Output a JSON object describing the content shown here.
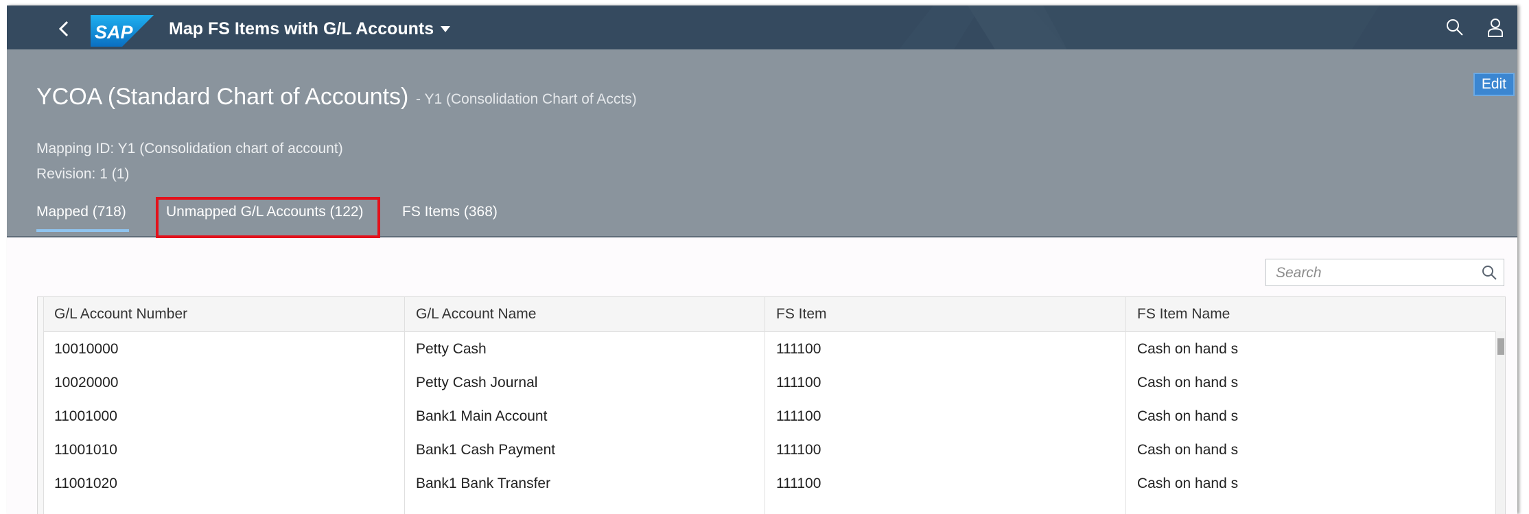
{
  "shell": {
    "app_title": "Map FS Items with G/L Accounts",
    "brand_color": "#354a5f",
    "icons": [
      "back-icon",
      "sap-logo",
      "search-icon",
      "user-icon"
    ]
  },
  "header": {
    "title": "YCOA (Standard Chart of Accounts)",
    "subtitle": "- Y1 (Consolidation Chart of Accts)",
    "edit_label": "Edit",
    "mapping_id": "Mapping ID: Y1 (Consolidation chart of account)",
    "revision": "Revision: 1 (1)",
    "background_color": "#8a949d"
  },
  "tabs": [
    {
      "label": "Mapped (718)",
      "selected": true
    },
    {
      "label": "Unmapped G/L Accounts (122)",
      "selected": false,
      "highlighted": true
    },
    {
      "label": "FS Items (368)",
      "selected": false
    }
  ],
  "highlight_color": "#e3111b",
  "search": {
    "placeholder": "Search",
    "value": ""
  },
  "table": {
    "columns": [
      "G/L Account Number",
      "G/L Account Name",
      "FS Item",
      "FS Item Name"
    ],
    "rows": [
      [
        "10010000",
        "Petty Cash",
        "111100",
        "Cash on hand s"
      ],
      [
        "10020000",
        "Petty Cash Journal",
        "111100",
        "Cash on hand s"
      ],
      [
        "11001000",
        "Bank1 Main Account",
        "111100",
        "Cash on hand s"
      ],
      [
        "11001010",
        "Bank1 Cash Payment",
        "111100",
        "Cash on hand s"
      ],
      [
        "11001020",
        "Bank1 Bank Transfer",
        "111100",
        "Cash on hand s"
      ]
    ]
  }
}
